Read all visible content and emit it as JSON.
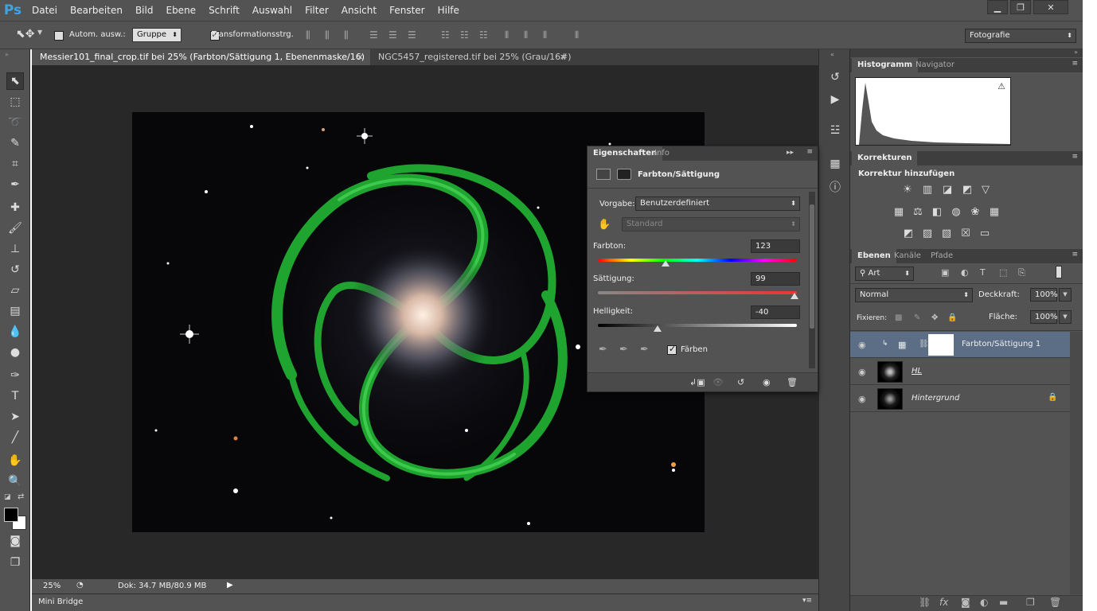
{
  "app": {
    "logo": "Ps"
  },
  "menu": [
    "Datei",
    "Bearbeiten",
    "Bild",
    "Ebene",
    "Schrift",
    "Auswahl",
    "Filter",
    "Ansicht",
    "Fenster",
    "Hilfe"
  ],
  "window_controls": [
    "minimize-icon",
    "restore-icon",
    "close-icon"
  ],
  "options": {
    "auto_select_label": "Autom. ausw.:",
    "auto_select_value": "Gruppe",
    "transform_label": "Transformationsstrg.",
    "workspace_value": "Fotografie"
  },
  "doc_tabs": [
    {
      "label": "Messier101_final_crop.tif bei 25% (Farbton/Sättigung 1, Ebenenmaske/16) *"
    },
    {
      "label": "NGC5457_registered.tif bei 25% (Grau/16#)"
    }
  ],
  "status": {
    "zoom": "25%",
    "doc": "Dok: 34.7 MB/80.9 MB"
  },
  "mini_bridge": "Mini Bridge",
  "properties": {
    "tabs": [
      "Eigenschaften",
      "Info"
    ],
    "title": "Farbton/Sättigung",
    "preset_label": "Vorgabe:",
    "preset_value": "Benutzerdefiniert",
    "channel_value": "Standard",
    "hue_label": "Farbton:",
    "hue_value": "123",
    "saturation_label": "Sättigung:",
    "saturation_value": "99",
    "lightness_label": "Helligkeit:",
    "lightness_value": "-40",
    "colorize_label": "Färben"
  },
  "histogram": {
    "tabs": [
      "Histogramm",
      "Navigator"
    ]
  },
  "adjustments": {
    "tab": "Korrekturen",
    "heading": "Korrektur hinzufügen"
  },
  "layers_panel": {
    "tabs": [
      "Ebenen",
      "Kanäle",
      "Pfade"
    ],
    "filter_value": "Art",
    "blend_mode": "Normal",
    "opacity_label": "Deckkraft:",
    "opacity_value": "100%",
    "lock_label": "Fixieren:",
    "fill_label": "Fläche:",
    "fill_value": "100%",
    "layers": [
      {
        "name": "Farbton/Sättigung 1",
        "selected": true
      },
      {
        "name": "HL",
        "selected": false
      },
      {
        "name": "Hintergrund",
        "selected": false
      }
    ]
  }
}
